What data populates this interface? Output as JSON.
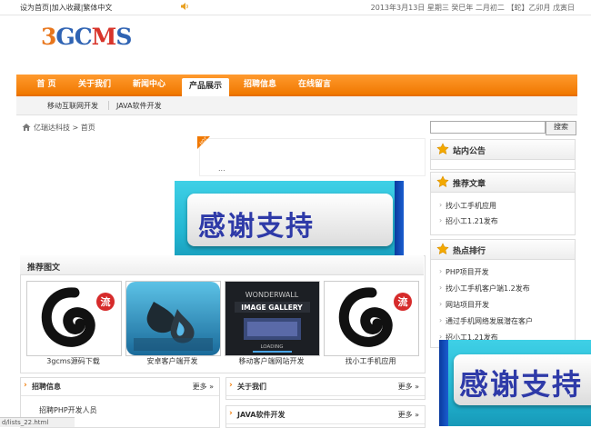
{
  "topbar": {
    "links": [
      "设为首页",
      "加入收藏",
      "繁体中文"
    ],
    "separator": "|",
    "date": "2013年3月13日 星期三 癸巳年 二月初二 【蛇】乙卯月 戊寅日"
  },
  "logo": {
    "digit": "3",
    "letters": [
      "G",
      "C",
      "M",
      "S"
    ],
    "colors": {
      "digit": "#e8761c",
      "G": "#2f63b3",
      "C": "#2f63b3",
      "M": "#d8342a",
      "S": "#2f63b3"
    }
  },
  "nav": {
    "items": [
      "首 页",
      "关于我们",
      "新闻中心",
      "产品展示",
      "招聘信息",
      "在线留言"
    ],
    "active_index": 3,
    "sub_items": [
      "移动互联网开发",
      "JAVA软件开发"
    ]
  },
  "breadcrumb": {
    "site": "亿瑞达科技",
    "sep": ">",
    "page": "首页"
  },
  "search": {
    "placeholder": "",
    "button": "搜索"
  },
  "hot": {
    "tag": "HOT",
    "text": "..."
  },
  "banner": {
    "text": "感谢支持"
  },
  "sidebar": {
    "notice": {
      "title": "站内公告"
    },
    "recommended": {
      "title": "推荐文章",
      "items": [
        "找小工手机应用",
        "招小工1.21发布"
      ]
    },
    "hot_rank": {
      "title": "热点排行",
      "items": [
        "PHP项目开发",
        "找小工手机客户端1.2发布",
        "网站项目开发",
        "通过手机网络发展潜在客户",
        "招小工1.21发布"
      ]
    }
  },
  "rec_gallery": {
    "title": "推荐图文",
    "items": [
      {
        "caption": "3gcms源码下载",
        "image": "swirl-logo"
      },
      {
        "caption": "安卓客户端开发",
        "image": "drop-app-icon"
      },
      {
        "caption": "移动客户端网站开发",
        "image": "wonderwall-gallery",
        "lines": [
          "WONDERWALL",
          "IMAGE GALLERY",
          "LOADING"
        ]
      },
      {
        "caption": "找小工手机应用",
        "image": "swirl-logo"
      }
    ],
    "badge": "流"
  },
  "bottom": {
    "jobs": {
      "title": "招聘信息",
      "more": "更多 »",
      "items": [
        "招聘PHP开发人员"
      ]
    },
    "about": {
      "title": "关于我们",
      "more": "更多 »"
    },
    "java": {
      "title": "JAVA软件开发",
      "more": "更多 »"
    }
  },
  "status_bar": {
    "url": "d/lists_22.html"
  }
}
